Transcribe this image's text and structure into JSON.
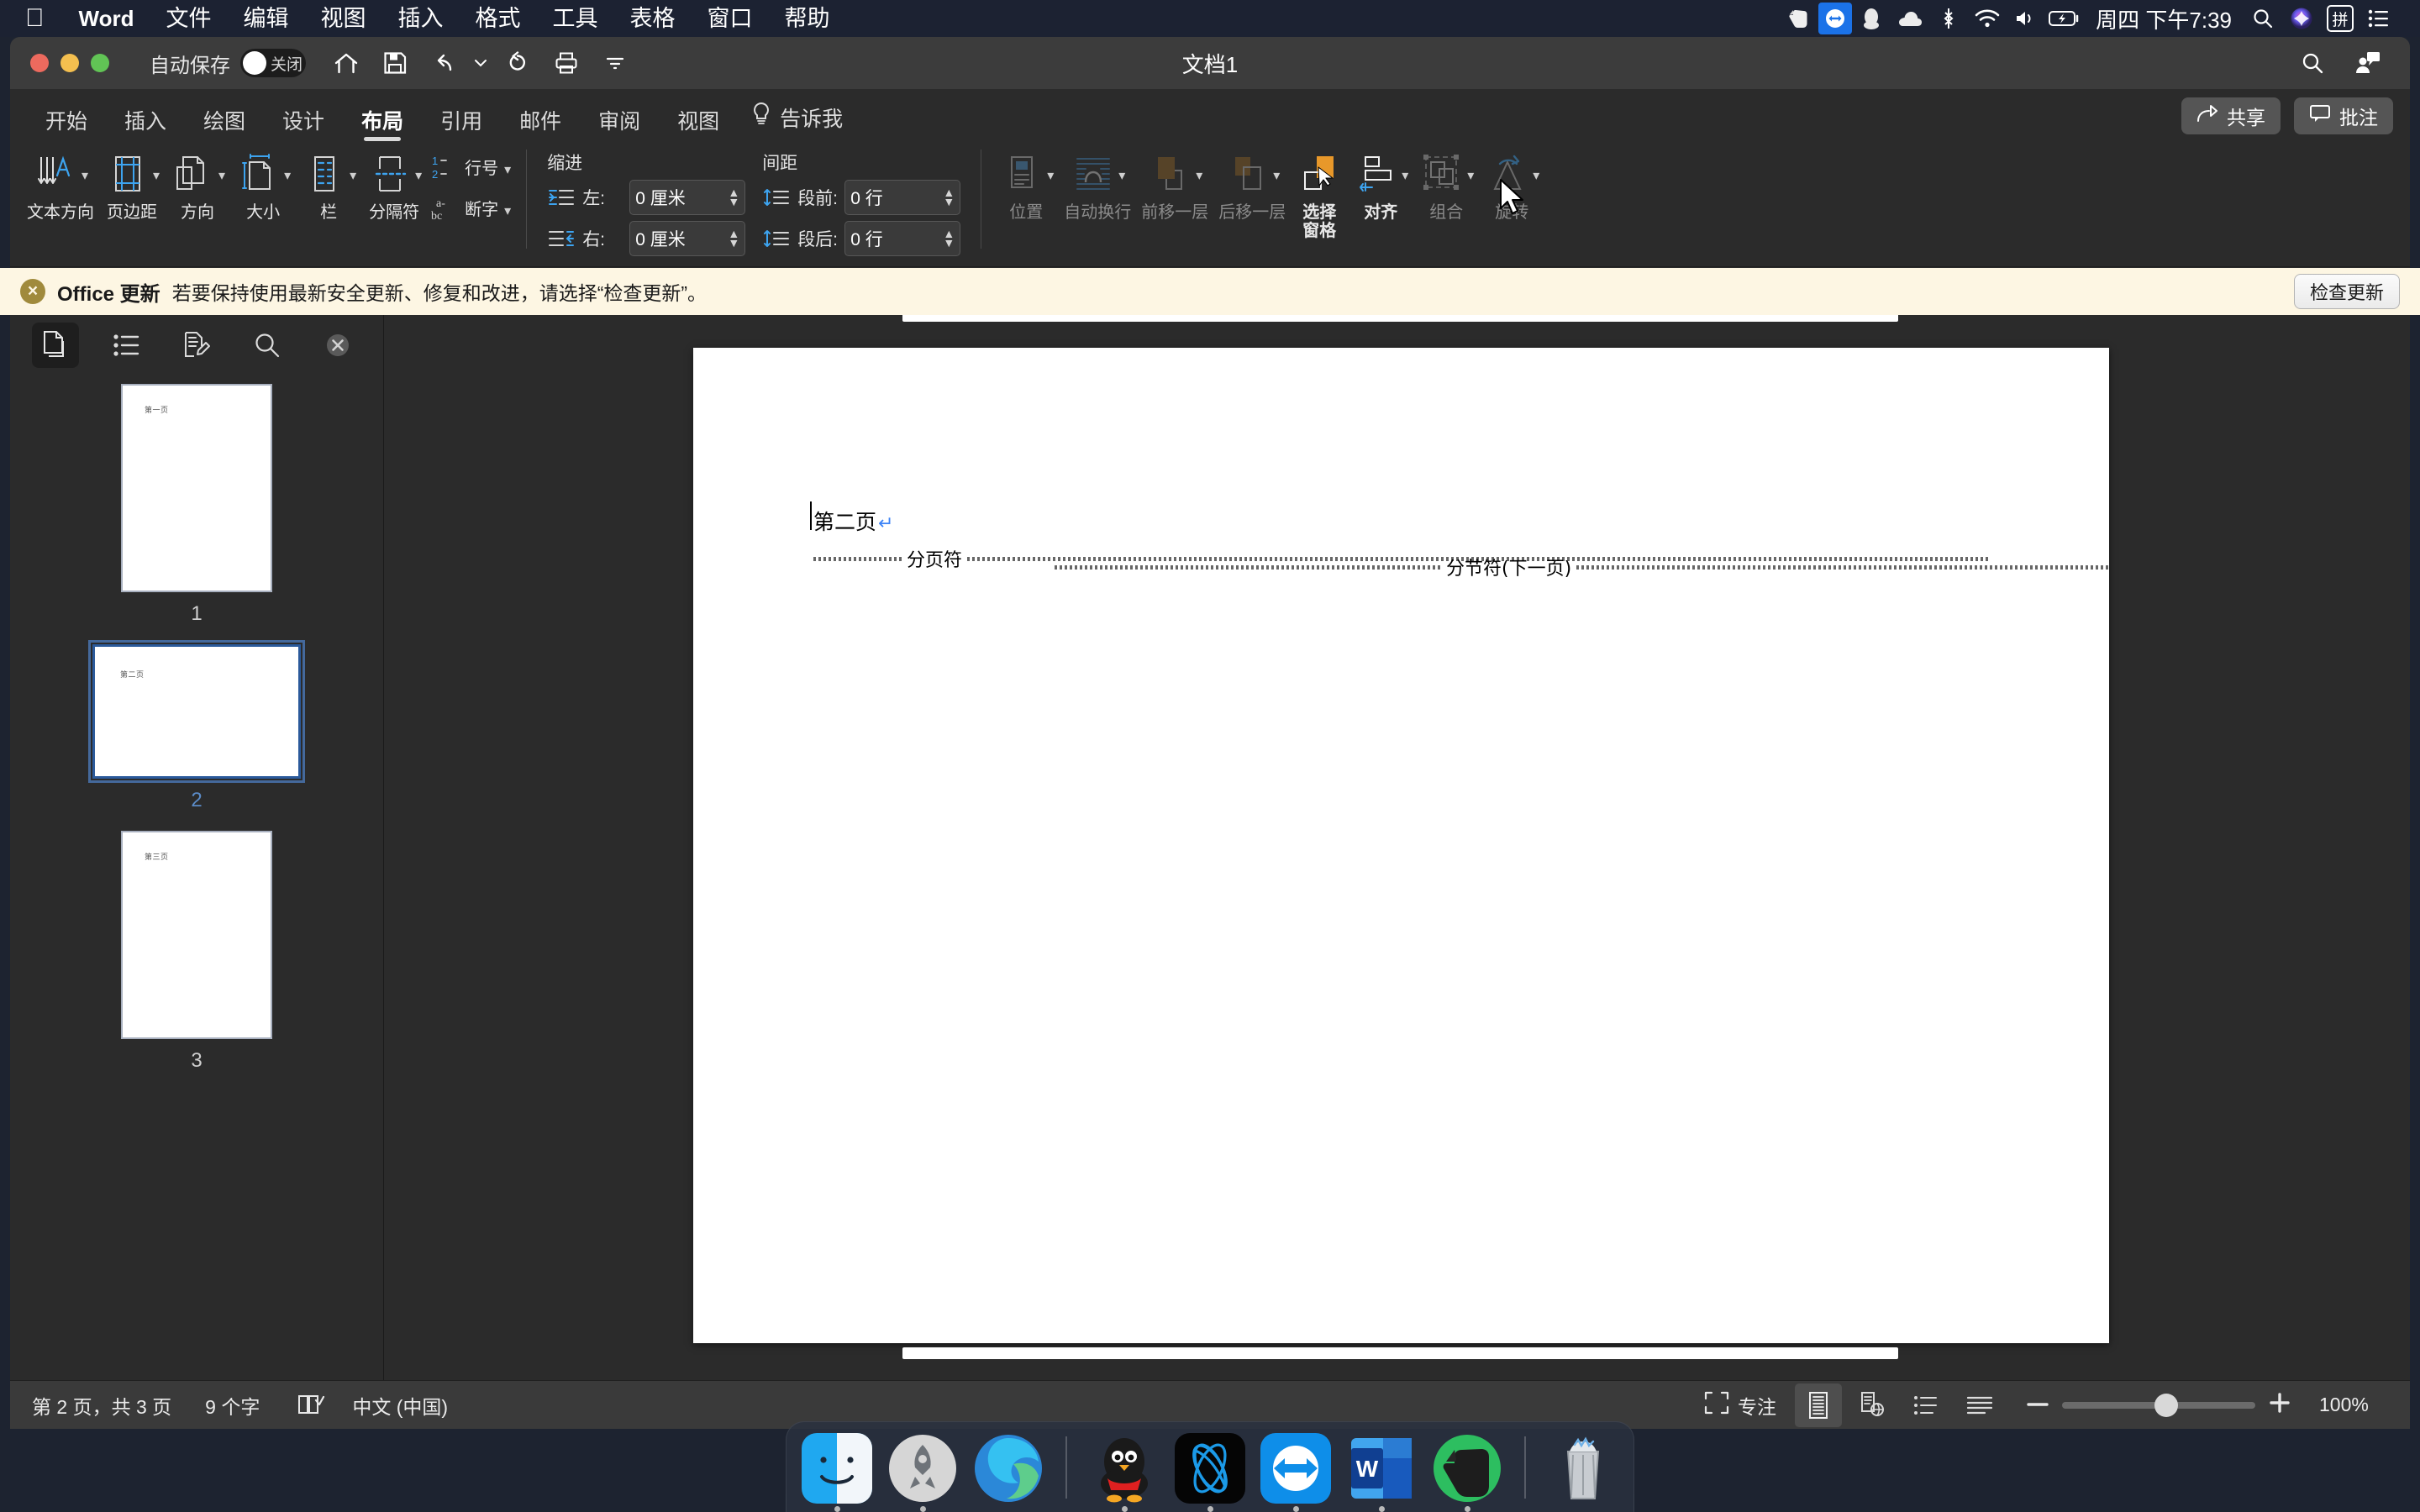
{
  "menubar": {
    "apple_icon": "apple-logo-icon",
    "app_name": "Word",
    "items": [
      "文件",
      "编辑",
      "视图",
      "插入",
      "格式",
      "工具",
      "表格",
      "窗口",
      "帮助"
    ],
    "status_icons": [
      "evernote-icon",
      "teamviewer-icon",
      "qq-penguin-icon",
      "cloud-icon",
      "bluetooth-icon",
      "wifi-icon",
      "volume-icon",
      "battery-charging-icon"
    ],
    "clock": "周四 下午7:39",
    "right_icons": [
      "search-icon",
      "siri-icon",
      "input-method-icon",
      "control-center-icon"
    ],
    "input_method_label": "拼"
  },
  "titlebar": {
    "autosave_label": "自动保存",
    "autosave_state": "关闭",
    "document_title": "文档1",
    "quick_access": [
      "home-icon",
      "save-icon",
      "undo-icon",
      "redo-icon",
      "print-icon",
      "customize-icon"
    ],
    "search_icon": "search-icon",
    "account_icon": "account-comment-icon"
  },
  "ribbon": {
    "tabs": [
      "开始",
      "插入",
      "绘图",
      "设计",
      "布局",
      "引用",
      "邮件",
      "审阅",
      "视图"
    ],
    "active_tab": "布局",
    "tell_me": "告诉我",
    "share_label": "共享",
    "comments_label": "批注",
    "page_setup": [
      {
        "label": "文本方向",
        "icon": "text-direction-icon",
        "caret": true,
        "disabled": false
      },
      {
        "label": "页边距",
        "icon": "margins-icon",
        "caret": true,
        "disabled": false
      },
      {
        "label": "方向",
        "icon": "orientation-icon",
        "caret": true,
        "disabled": false
      },
      {
        "label": "大小",
        "icon": "page-size-icon",
        "caret": true,
        "disabled": false
      },
      {
        "label": "栏",
        "icon": "columns-icon",
        "caret": true,
        "disabled": false
      },
      {
        "label": "分隔符",
        "icon": "breaks-icon",
        "caret": true,
        "disabled": false
      }
    ],
    "page_setup_stacked": [
      {
        "label": "行号",
        "icon": "line-numbers-icon",
        "caret": true
      },
      {
        "label": "断字",
        "icon": "hyphenation-icon",
        "caret": true
      }
    ],
    "indent": {
      "header": "缩进",
      "rows": [
        {
          "icon": "indent-left-icon",
          "label": "左:",
          "value": "0 厘米"
        },
        {
          "icon": "indent-right-icon",
          "label": "右:",
          "value": "0 厘米"
        }
      ]
    },
    "spacing": {
      "header": "间距",
      "rows": [
        {
          "icon": "space-before-icon",
          "label": "段前:",
          "value": "0 行"
        },
        {
          "icon": "space-after-icon",
          "label": "段后:",
          "value": "0 行"
        }
      ]
    },
    "arrange": [
      {
        "label": "位置",
        "icon": "position-icon",
        "caret": true,
        "disabled": true
      },
      {
        "label": "自动换行",
        "icon": "wrap-text-icon",
        "caret": true,
        "disabled": true
      },
      {
        "label": "前移一层",
        "icon": "bring-forward-icon",
        "caret": true,
        "disabled": true
      },
      {
        "label": "后移一层",
        "icon": "send-backward-icon",
        "caret": true,
        "disabled": true
      },
      {
        "label": "选择\n窗格",
        "icon": "selection-pane-icon",
        "caret": false,
        "disabled": false
      },
      {
        "label": "对齐",
        "icon": "align-objects-icon",
        "caret": true,
        "disabled": false
      },
      {
        "label": "组合",
        "icon": "group-objects-icon",
        "caret": true,
        "disabled": true
      },
      {
        "label": "旋转",
        "icon": "rotate-objects-icon",
        "caret": true,
        "disabled": true
      }
    ]
  },
  "notice": {
    "close_icon": "close-circle-icon",
    "bold_text": "Office 更新",
    "message": "若要保持使用最新安全更新、修复和改进，请选择“检查更新”。",
    "button_label": "检查更新",
    "background": "#fdf6e3"
  },
  "sidebar": {
    "tools": [
      "thumbnails-pane-icon",
      "outline-list-icon",
      "review-edit-icon",
      "search-icon"
    ],
    "active_tool": "thumbnails-pane-icon",
    "close_icon": "close-circle-icon",
    "thumbnails": [
      {
        "number": "1",
        "orientation": "portrait",
        "text": "第一页",
        "selected": false
      },
      {
        "number": "2",
        "orientation": "landscape",
        "text": "第二页",
        "selected": true
      },
      {
        "number": "3",
        "orientation": "portrait",
        "text": "第三页",
        "selected": false
      }
    ]
  },
  "document": {
    "body_text": "第二页",
    "paragraph_mark": "↵",
    "page_break_label": "分页符",
    "section_break_label": "分节符(下一页)"
  },
  "statusbar": {
    "page_info": "第 2 页，共 3 页",
    "word_count": "9 个字",
    "proofing_icon": "proofing-check-icon",
    "language": "中文 (中国)",
    "focus_label": "专注",
    "focus_icon": "focus-mode-icon",
    "views": [
      "print-layout-icon",
      "web-layout-icon",
      "outline-view-icon",
      "draft-view-icon"
    ],
    "active_view": "print-layout-icon",
    "zoom_out_icon": "minus-icon",
    "zoom_in_icon": "plus-icon",
    "zoom_level": "100%"
  },
  "dock": {
    "apps": [
      {
        "name": "finder-icon",
        "running": true
      },
      {
        "name": "launchpad-icon",
        "running": true
      },
      {
        "name": "microsoft-edge-icon",
        "running": false
      },
      {
        "name": "qq-icon",
        "running": true
      },
      {
        "name": "blue-swirl-app-icon",
        "running": true
      },
      {
        "name": "teamviewer-icon",
        "running": true
      },
      {
        "name": "microsoft-word-icon",
        "running": true
      },
      {
        "name": "evernote-icon",
        "running": true
      },
      {
        "name": "trash-icon",
        "running": false
      }
    ]
  },
  "colors": {
    "menubar_bg": "#1c2232",
    "window_bg": "#2b2b2b",
    "titlebar_bg": "#3c3c3c",
    "accent_blue": "#1b72e8",
    "notice_bg": "#fdf6e3",
    "selection_blue": "#2b5a9b"
  }
}
